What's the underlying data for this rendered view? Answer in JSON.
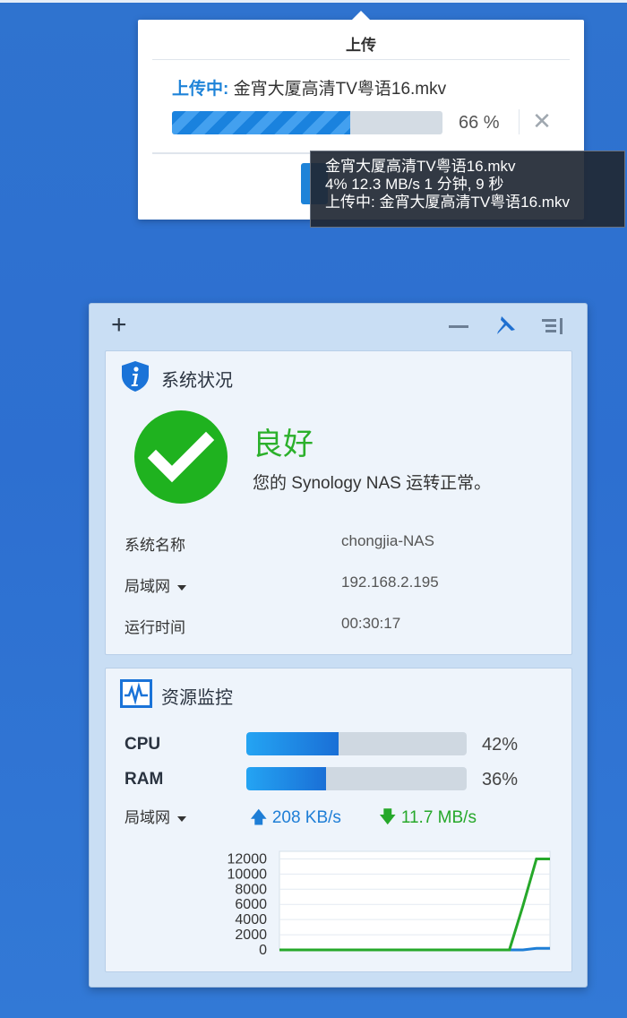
{
  "upload": {
    "title": "上传",
    "status_label": "上传中:",
    "filename": "金宵大厦高清TV粤语16.mkv",
    "progress": 0.66,
    "percent_text": "66 %"
  },
  "tooltip": {
    "line1": "金宵大厦高清TV粤语16.mkv",
    "line2": "4% 12.3 MB/s 1 分钟, 9 秒",
    "line3": "上传中: 金宵大厦高清TV粤语16.mkv"
  },
  "system_status": {
    "title": "系统状况",
    "state": "良好",
    "description": "您的 Synology NAS 运转正常。",
    "rows": [
      {
        "label": "系统名称",
        "value": "chongjia-NAS"
      },
      {
        "label": "局域网",
        "value": "192.168.2.195"
      },
      {
        "label": "运行时间",
        "value": "00:30:17"
      }
    ]
  },
  "resource_monitor": {
    "title": "资源监控",
    "cpu_label": "CPU",
    "cpu_value": 0.42,
    "cpu_text": "42%",
    "ram_label": "RAM",
    "ram_value": 0.36,
    "ram_text": "36%",
    "net_label": "局域网",
    "upload_rate": "208 KB/s",
    "download_rate": "11.7 MB/s"
  },
  "colors": {
    "upload_series": "#1e7ed6",
    "download_series": "#26a82a",
    "ok_green": "#1fb21f"
  },
  "chart_data": {
    "type": "line",
    "ylim": [
      0,
      13000
    ],
    "yticks": [
      "12000",
      "10000",
      "8000",
      "6000",
      "4000",
      "2000",
      "0"
    ],
    "ytick_values": [
      12000,
      10000,
      8000,
      6000,
      4000,
      2000,
      0
    ],
    "x": [
      0,
      1,
      2,
      3,
      4,
      5,
      6,
      7,
      8,
      9,
      10,
      11,
      12,
      13,
      14,
      15,
      16,
      17,
      18,
      19,
      20
    ],
    "series": [
      {
        "values": [
          0,
          0,
          0,
          0,
          0,
          0,
          0,
          0,
          0,
          0,
          0,
          0,
          0,
          0,
          0,
          0,
          0,
          0,
          0,
          200,
          208
        ],
        "color": "#1e7ed6"
      },
      {
        "values": [
          0,
          0,
          0,
          0,
          0,
          0,
          0,
          0,
          0,
          0,
          0,
          0,
          0,
          0,
          0,
          0,
          0,
          0,
          5800,
          12000,
          12000
        ],
        "color": "#26a82a"
      }
    ],
    "grid": true
  }
}
